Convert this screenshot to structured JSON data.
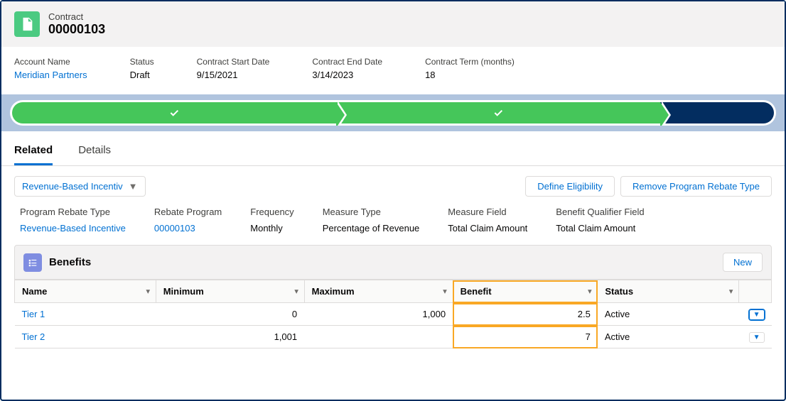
{
  "header": {
    "type_label": "Contract",
    "number": "00000103"
  },
  "fields": {
    "account_name": {
      "label": "Account Name",
      "value": "Meridian Partners"
    },
    "status": {
      "label": "Status",
      "value": "Draft"
    },
    "start": {
      "label": "Contract Start Date",
      "value": "9/15/2021"
    },
    "end": {
      "label": "Contract End Date",
      "value": "3/14/2023"
    },
    "term": {
      "label": "Contract Term (months)",
      "value": "18"
    }
  },
  "tabs": {
    "related": "Related",
    "details": "Details"
  },
  "dropdown": {
    "label": "Revenue-Based Incentiv"
  },
  "actions": {
    "define": "Define Eligibility",
    "remove": "Remove Program Rebate Type"
  },
  "rebate_details": {
    "type": {
      "label": "Program Rebate Type",
      "value": "Revenue-Based Incentive"
    },
    "program": {
      "label": "Rebate Program",
      "value": "00000103"
    },
    "frequency": {
      "label": "Frequency",
      "value": "Monthly"
    },
    "measure_type": {
      "label": "Measure Type",
      "value": "Percentage of Revenue"
    },
    "measure_field": {
      "label": "Measure Field",
      "value": "Total Claim Amount"
    },
    "qualifier": {
      "label": "Benefit Qualifier Field",
      "value": "Total Claim Amount"
    }
  },
  "benefits": {
    "title": "Benefits",
    "new_label": "New"
  },
  "table": {
    "cols": {
      "name": "Name",
      "min": "Minimum",
      "max": "Maximum",
      "benefit": "Benefit",
      "status": "Status"
    },
    "rows": [
      {
        "name": "Tier 1",
        "min": "0",
        "max": "1,000",
        "benefit": "2.5",
        "status": "Active"
      },
      {
        "name": "Tier 2",
        "min": "1,001",
        "max": "",
        "benefit": "7",
        "status": "Active"
      }
    ]
  }
}
